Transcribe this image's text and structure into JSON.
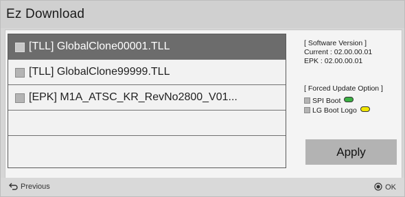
{
  "window": {
    "title": "Ez Download"
  },
  "files": [
    {
      "label": "[TLL] GlobalClone00001.TLL",
      "selected": true
    },
    {
      "label": "[TLL] GlobalClone99999.TLL",
      "selected": false
    },
    {
      "label": "[EPK] M1A_ATSC_KR_RevNo2800_V01...",
      "selected": false
    },
    {
      "label": "",
      "selected": false
    },
    {
      "label": "",
      "selected": false
    }
  ],
  "software_version": {
    "heading": "[ Software Version ]",
    "current": "Current : 02.00.00.01",
    "epk": "EPK : 02.00.00.01"
  },
  "forced_update": {
    "heading": "[ Forced Update Option ]",
    "options": [
      {
        "label": "SPI Boot",
        "color": "#3cb043"
      },
      {
        "label": "LG Boot Logo",
        "color": "#f2e600"
      }
    ]
  },
  "apply_label": "Apply",
  "footer": {
    "previous_label": "Previous",
    "previous_icon": "back-arrow-icon",
    "ok_label": "OK",
    "ok_icon": "ok-circle-icon"
  }
}
